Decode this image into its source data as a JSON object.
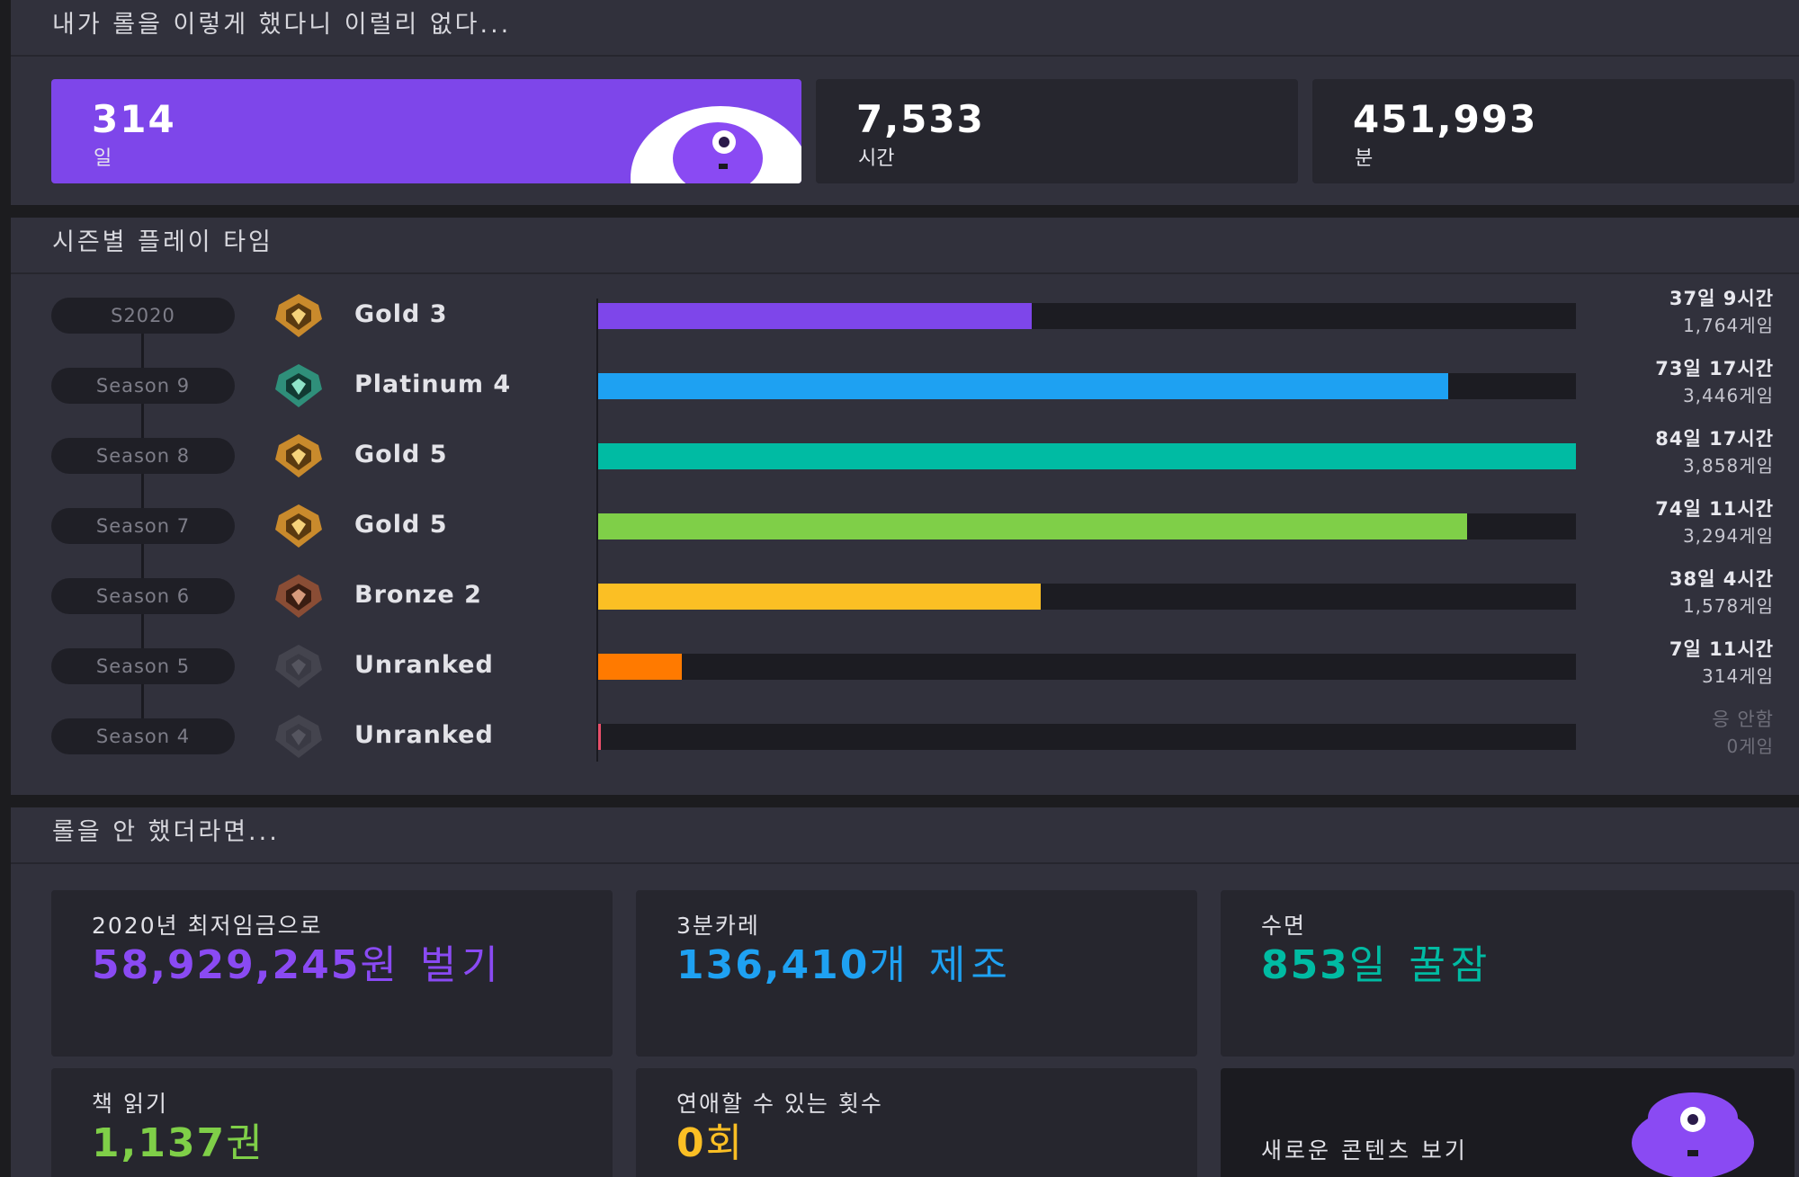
{
  "summary": {
    "title": "내가 롤을 이렇게 했다니 이럴리 없다...",
    "cards": [
      {
        "value": "314",
        "unit": "일"
      },
      {
        "value": "7,533",
        "unit": "시간"
      },
      {
        "value": "451,993",
        "unit": "분"
      }
    ]
  },
  "seasons": {
    "title": "시즌별 플레이 타임",
    "rows": [
      {
        "season": "S2020",
        "tier": "Gold 3",
        "tier_icon": "gold-emblem-icon",
        "main": "37일 9시간",
        "sub": "1,764게임",
        "fraction": 0.443,
        "color": "#7e46ea"
      },
      {
        "season": "Season 9",
        "tier": "Platinum 4",
        "tier_icon": "platinum-emblem-icon",
        "main": "73일 17시간",
        "sub": "3,446게임",
        "fraction": 0.869,
        "color": "#1ea1f2"
      },
      {
        "season": "Season 8",
        "tier": "Gold 5",
        "tier_icon": "gold-emblem-icon",
        "main": "84일 17시간",
        "sub": "3,858게임",
        "fraction": 1.0,
        "color": "#00bba3"
      },
      {
        "season": "Season 7",
        "tier": "Gold 5",
        "tier_icon": "gold-emblem-icon",
        "main": "74일 11시간",
        "sub": "3,294게임",
        "fraction": 0.889,
        "color": "#7fcf48"
      },
      {
        "season": "Season 6",
        "tier": "Bronze 2",
        "tier_icon": "bronze-emblem-icon",
        "main": "38일 4시간",
        "sub": "1,578게임",
        "fraction": 0.453,
        "color": "#fbbf24"
      },
      {
        "season": "Season 5",
        "tier": "Unranked",
        "tier_icon": "unranked-emblem-icon",
        "main": "7일 11시간",
        "sub": "314게임",
        "fraction": 0.086,
        "color": "#ff7a00"
      },
      {
        "season": "Season 4",
        "tier": "Unranked",
        "tier_icon": "unranked-emblem-icon",
        "main": "응 안함",
        "sub": "0게임",
        "fraction": 0.0,
        "color": "#e84e6a"
      }
    ]
  },
  "alternatives": {
    "title": "롤을 안 했더라면...",
    "cards": [
      {
        "label": "2020년 최저임금으로",
        "value": "58,929,245",
        "unit": "원 벌기",
        "color": "#8a4af3"
      },
      {
        "label": "3분카레",
        "value": "136,410",
        "unit": "개 제조",
        "color": "#1ea1f2"
      },
      {
        "label": "수면",
        "value": "853",
        "unit": "일 꿀잠",
        "color": "#00bba3"
      },
      {
        "label": "책 읽기",
        "value": "1,137",
        "unit": "권",
        "color": "#7fcf48"
      },
      {
        "label": "연애할 수 있는 횟수",
        "value": "0",
        "unit": "회",
        "color": "#fbbf24"
      }
    ],
    "new_content": "새로운 콘텐츠 보기"
  },
  "colors": {
    "accent": "#7e46ea",
    "panel": "#31313c",
    "card": "#26262e"
  }
}
